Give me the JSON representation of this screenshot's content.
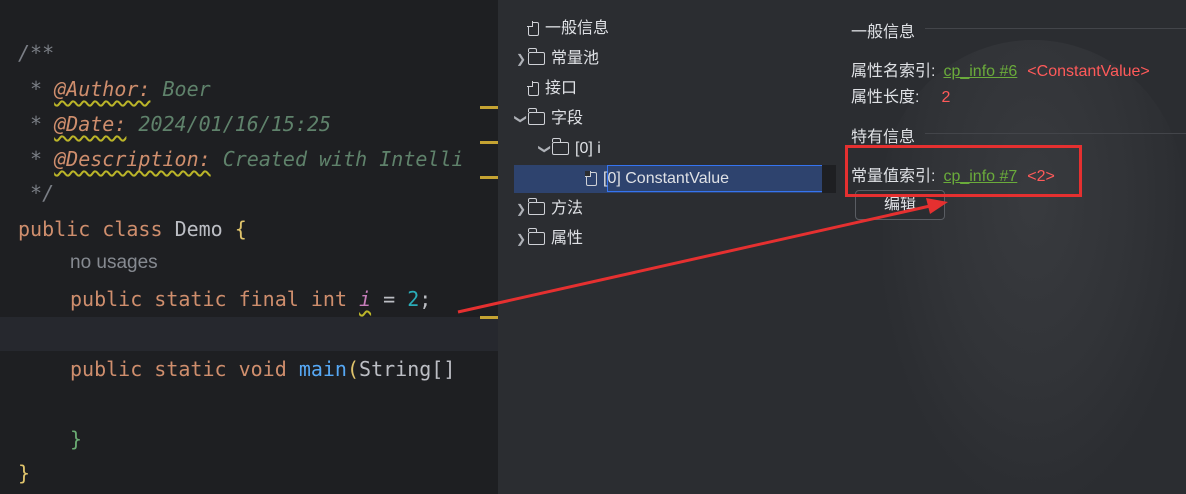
{
  "editor": {
    "doc_open": "/**",
    "author_tag": "@Author:",
    "author_value": "Boer",
    "date_tag": "@Date:",
    "date_value": "2024/01/16/15:25",
    "desc_tag": "@Description:",
    "desc_value": "Created with Intelli",
    "doc_close": "*/",
    "kw_public": "public",
    "kw_class": "class",
    "class_name": "Demo",
    "open_brace": "{",
    "usages_hint": "no usages",
    "kw_static": "static",
    "kw_final": "final",
    "kw_int": "int",
    "field_name": "i",
    "assign": "=",
    "field_value": "2",
    "semicolon": ";",
    "kw_void": "void",
    "method_name": "main",
    "param_type": "String[]",
    "close_brace": "}"
  },
  "tree": {
    "items": [
      {
        "label": "一般信息"
      },
      {
        "label": "常量池"
      },
      {
        "label": "接口"
      },
      {
        "label": "字段"
      },
      {
        "label": "[0] i"
      },
      {
        "label": "[0] ConstantValue"
      },
      {
        "label": "方法"
      },
      {
        "label": "属性"
      }
    ]
  },
  "info": {
    "general_title": "一般信息",
    "name_index_label": "属性名索引:",
    "name_index_link": "cp_info #6",
    "name_index_value": "<ConstantValue>",
    "length_label": "属性长度:",
    "length_value": "2",
    "specific_title": "特有信息",
    "const_index_label": "常量值索引:",
    "const_index_link": "cp_info #7",
    "const_index_value": "<2>",
    "edit_button": "编辑"
  },
  "colors": {
    "annotation_box": "#e53030",
    "arrow": "#e53030",
    "link_green": "#6aab3b",
    "value_red": "#ff5a5a"
  }
}
